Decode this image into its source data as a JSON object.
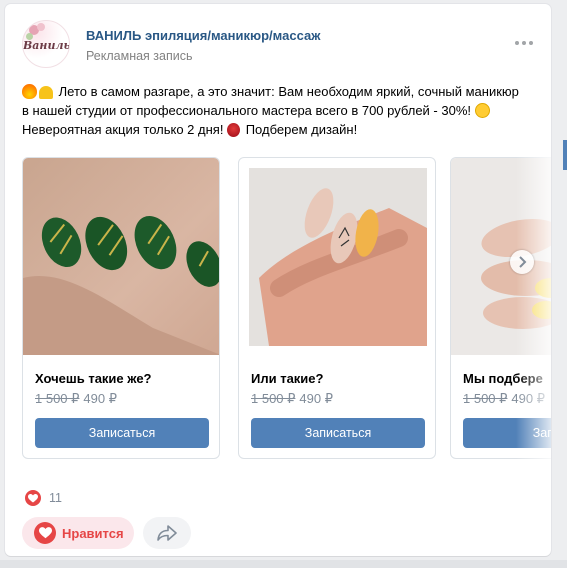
{
  "post": {
    "group_name": "ВАНИЛЬ эпиляция/маникюр/массаж",
    "post_type": "Рекламная запись",
    "avatar_logo": "Ваниль",
    "text_line1": "Лето в самом разгаре, а это значит: Вам необходим яркий, сочный маникюр",
    "text_line2": "в нашей студии от профессионального мастера всего в 700 рублей - 30%!",
    "text_line3a": "Невероятная акция только 2 дня!",
    "text_line3b": "Подберем дизайн!"
  },
  "carousel": {
    "cards": [
      {
        "title": "Хочешь такие же?",
        "old_price": "1 500 ₽",
        "new_price": "490 ₽",
        "button": "Записаться"
      },
      {
        "title": "Или такие?",
        "old_price": "1 500 ₽",
        "new_price": "490 ₽",
        "button": "Записаться"
      },
      {
        "title": "Мы подбере",
        "old_price": "1 500 ₽",
        "new_price": "490 ₽",
        "button": "Запис"
      }
    ]
  },
  "footer": {
    "reaction_count": "11",
    "like_label": "Нравится"
  },
  "icons": {
    "more": "more-dots-icon",
    "next": "chevron-right-icon",
    "like": "heart-icon",
    "share": "share-arrow-icon"
  },
  "colors": {
    "link": "#2a5885",
    "button": "#5181b8",
    "like": "#e64646",
    "muted": "#818c99"
  }
}
